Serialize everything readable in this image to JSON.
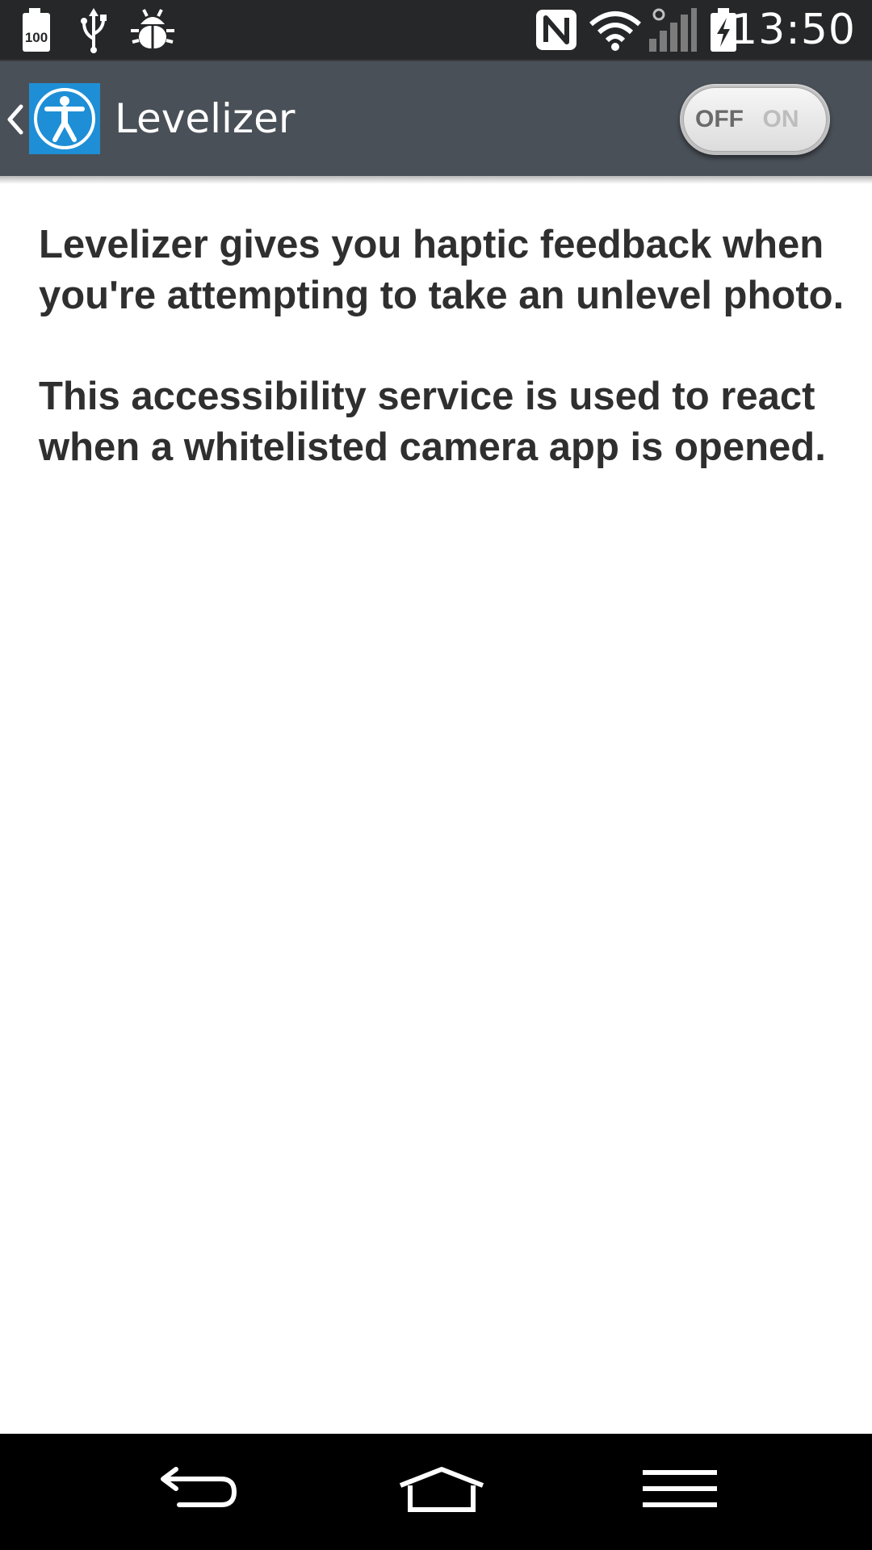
{
  "status_bar": {
    "time": "13:50",
    "battery_notification_level": "100",
    "icons": [
      "battery-100-notification-icon",
      "usb-icon",
      "debug-bug-icon",
      "nfc-icon",
      "wifi-icon",
      "signal-icon",
      "battery-charging-icon"
    ]
  },
  "action_bar": {
    "title": "Levelizer",
    "back_icon": "chevron-left-icon",
    "app_icon": "accessibility-icon",
    "toggle": {
      "off_label": "OFF",
      "on_label": "ON",
      "state": "off"
    }
  },
  "content": {
    "paragraphs": [
      "Levelizer gives you haptic feedback when you're attempting to take an unlevel photo.",
      "This accessibility service is used to react when a whitelisted camera app is opened."
    ]
  },
  "nav_bar": {
    "icons": [
      "back-icon",
      "home-icon",
      "menu-icon"
    ]
  },
  "colors": {
    "status_bar": "#262728",
    "action_bar": "#4a5058",
    "app_icon_blue": "#1e8fd6",
    "text": "#2f2f2f",
    "nav_bar": "#000000"
  }
}
